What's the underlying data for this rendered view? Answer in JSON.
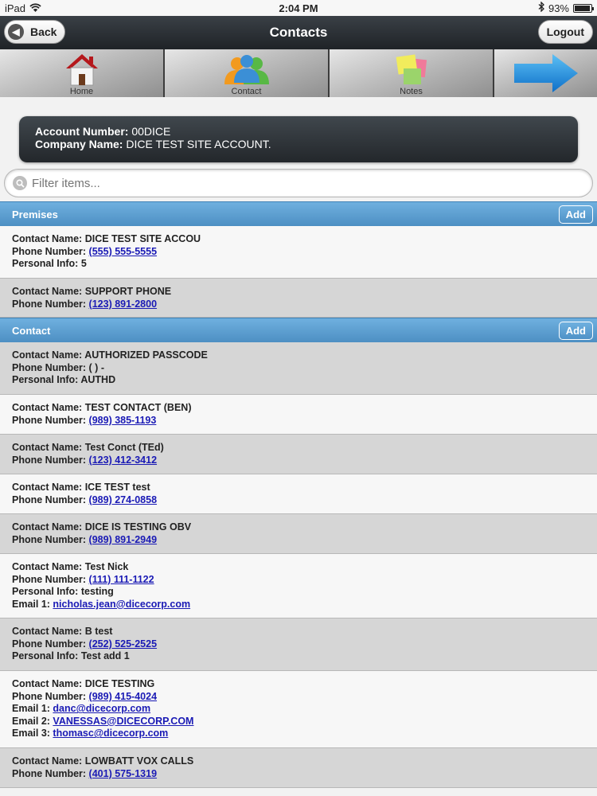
{
  "status_bar": {
    "device": "iPad",
    "time": "2:04 PM",
    "battery": "93%",
    "battery_level": 0.93
  },
  "header": {
    "title": "Contacts",
    "back_label": "Back",
    "logout_label": "Logout"
  },
  "nav": {
    "home_label": "Home",
    "contact_label": "Contact",
    "notes_label": "Notes"
  },
  "account": {
    "account_number_label": "Account Number:",
    "account_number": "00DICE",
    "company_name_label": "Company Name:",
    "company_name": "DICE TEST SITE ACCOUNT."
  },
  "filter": {
    "placeholder": "Filter items..."
  },
  "labels": {
    "contact_name": "Contact Name:",
    "phone_number": "Phone Number:",
    "personal_info": "Personal Info:",
    "email_1": "Email 1:",
    "email_2": "Email 2:",
    "email_3": "Email 3:"
  },
  "premises": {
    "title": "Premises",
    "add_label": "Add",
    "items": [
      {
        "name": "DICE TEST SITE ACCOU",
        "phone": "(555) 555-5555",
        "personal": "5"
      },
      {
        "name": "SUPPORT PHONE",
        "phone": "(123) 891-2800"
      }
    ]
  },
  "contact": {
    "title": "Contact",
    "add_label": "Add",
    "items": [
      {
        "name": "AUTHORIZED PASSCODE",
        "phone_text": "( ) -",
        "personal": "AUTHD"
      },
      {
        "name": "TEST CONTACT (BEN)",
        "phone": "(989) 385-1193"
      },
      {
        "name": "Test Conct (TEd)",
        "phone": "(123) 412-3412"
      },
      {
        "name": "ICE TEST test",
        "phone": "(989) 274-0858"
      },
      {
        "name": "DICE IS TESTING OBV",
        "phone": "(989) 891-2949"
      },
      {
        "name": "Test Nick",
        "phone": "(111) 111-1122",
        "personal": "testing",
        "email1": "nicholas.jean@dicecorp.com"
      },
      {
        "name": "B test",
        "phone": "(252) 525-2525",
        "personal": "Test add 1"
      },
      {
        "name": "DICE TESTING",
        "phone": "(989) 415-4024",
        "email1": "danc@dicecorp.com",
        "email2": "VANESSAS@DICECORP.COM",
        "email3": "thomasc@dicecorp.com"
      },
      {
        "name": "LOWBATT VOX CALLS",
        "phone": "(401) 575-1319"
      }
    ]
  },
  "colors": {
    "section_blue": "#5b9ed3",
    "link_blue": "#1a1ab5",
    "header_dark": "#2b3035"
  }
}
